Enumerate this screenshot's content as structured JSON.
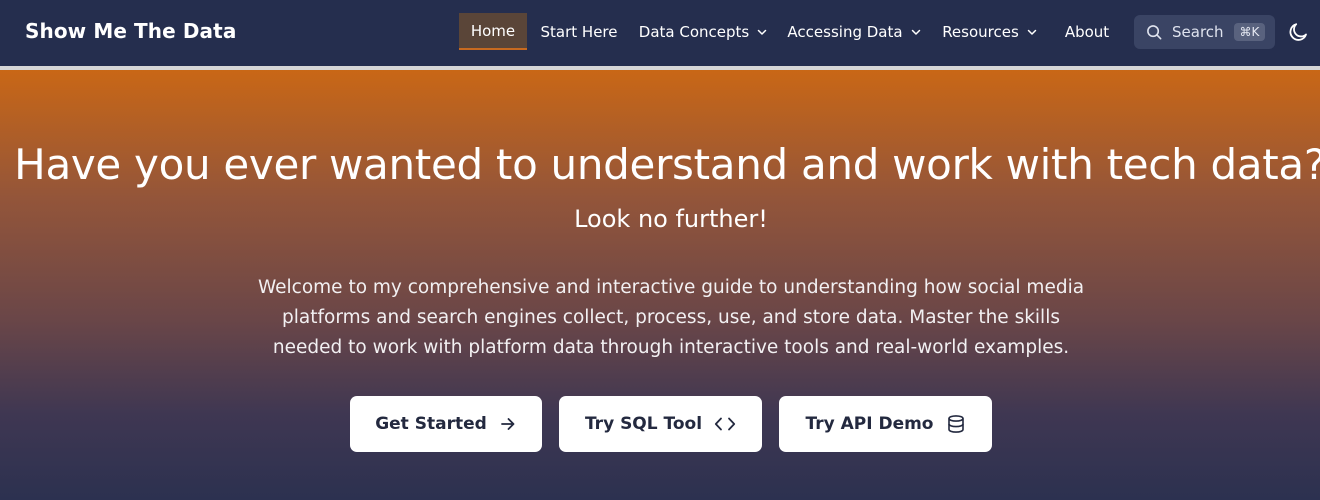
{
  "navbar": {
    "brand": "Show Me The Data",
    "items": [
      {
        "label": "Home",
        "active": true
      },
      {
        "label": "Start Here"
      },
      {
        "label": "Data Concepts",
        "dropdown": true
      },
      {
        "label": "Accessing Data",
        "dropdown": true
      },
      {
        "label": "Resources",
        "dropdown": true
      },
      {
        "label": "About"
      }
    ],
    "search": {
      "label": "Search",
      "shortcut": "⌘K",
      "icon": "search-icon"
    },
    "theme_toggle_icon": "moon-icon"
  },
  "hero": {
    "title": "Have you ever wanted to understand and work with tech data?",
    "subtitle": "Look no further!",
    "description": "Welcome to my comprehensive and interactive guide to understanding how social media platforms and search engines collect, process, use, and store data. Master the skills needed to work with platform data through interactive tools and real-world examples.",
    "buttons": [
      {
        "label": "Get Started",
        "icon": "arrow-right-icon"
      },
      {
        "label": "Try SQL Tool",
        "icon": "code-icon"
      },
      {
        "label": "Try API Demo",
        "icon": "database-icon"
      }
    ]
  },
  "colors": {
    "navbar_bg": "#252e4e",
    "active_tab_bg": "#5a4538",
    "accent": "#c86a20",
    "gradient_top": "#c96716",
    "gradient_bottom": "#2c3150"
  }
}
